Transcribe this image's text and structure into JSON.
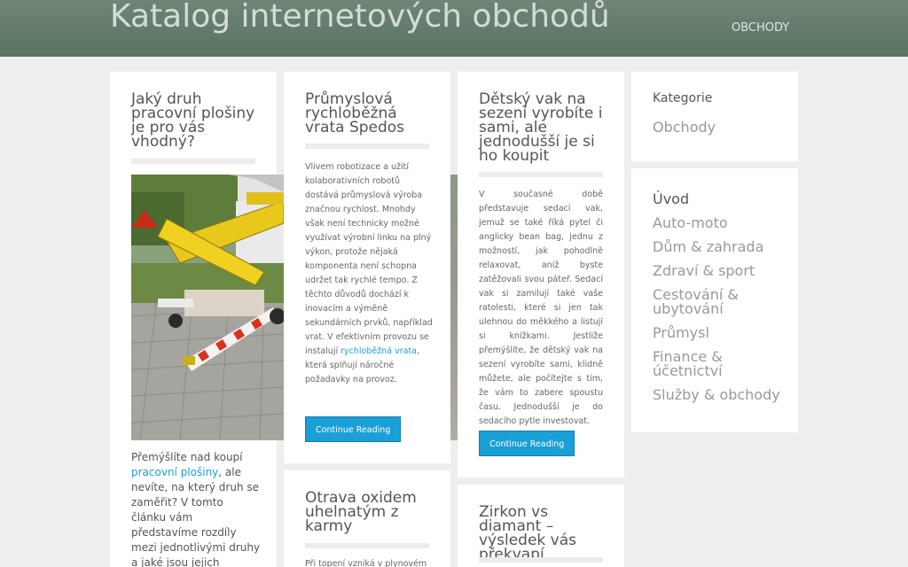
{
  "header": {
    "site_title": "Katalog internetových obchodů",
    "nav": [
      "OBCHODY"
    ]
  },
  "posts": [
    {
      "title": "Jaký druh pracovní plošiny je pro vás vhodný?",
      "image": "mobile-lifting-platform-photo",
      "excerpt_before": "Přemýšlíte nad koupí ",
      "excerpt_link": "pracovní plošiny",
      "excerpt_after": ", ale nevíte, na který druh se zaměřit? V tomto článku vám představíme rozdíly mezi jednotlivými druhy a jaké jsou jejich výhody."
    },
    {
      "title": "Průmyslová rychloběžná vrata Spedos",
      "excerpt_before": "Vlivem robotizace a užití kolaborativních robotů dostává průmyslová výroba značnou rychlost. Mnohdy však není technicky možné využívat výrobní linku na plný výkon, protože nějaká komponenta není schopna udržet tak rychlé tempo. Z těchto důvodů dochází k inovacím a výměně sekundárních prvků, například vrat. V efektivním provozu se instalují ",
      "excerpt_link": "rychloběžná vrata",
      "excerpt_after": ", která splňují náročné požadavky na provoz.",
      "button": "Continue Reading"
    },
    {
      "title": "Dětský vak na sezení vyrobíte i sami, ale jednodušší je si ho koupit",
      "excerpt": "V současné době představuje sedací vak, jemuž se také říká pytel či anglicky bean bag, jednu z možností, jak pohodlně relaxovat, aniž byste zatěžovali svou páteř. Sedací vak si zamilují také vaše ratolesti, které si jen tak ulehnou do měkkého a listují si knížkami. Jestliže přemýšlíte, že dětský vak na sezení vyrobíte sami, klidně můžete, ale počítejte s tím, že vám to zabere spoustu času. Jednodušší je do sedacího pytle investovat.",
      "button": "Continue Reading"
    },
    {
      "title": "Otrava oxidem uhelnatým z karmy",
      "excerpt": "Při topení vzniká v plynovém"
    },
    {
      "title": "Zirkon vs diamant – výsledek vás překvapí"
    }
  ],
  "sidebar": {
    "categories_title": "Kategorie",
    "categories": [
      "Obchody"
    ],
    "menu": [
      "Úvod",
      "Auto-moto",
      "Dům & zahrada",
      "Zdraví & sport",
      "Cestování & ubytování",
      "Průmysl",
      "Finance & účetnictví",
      "Služby & obchody"
    ],
    "active": "Úvod"
  },
  "colors": {
    "header_bg": "#5f7868",
    "link": "#1a9fd6",
    "button": "#1a9fd6",
    "page_bg": "#eeeeee"
  }
}
